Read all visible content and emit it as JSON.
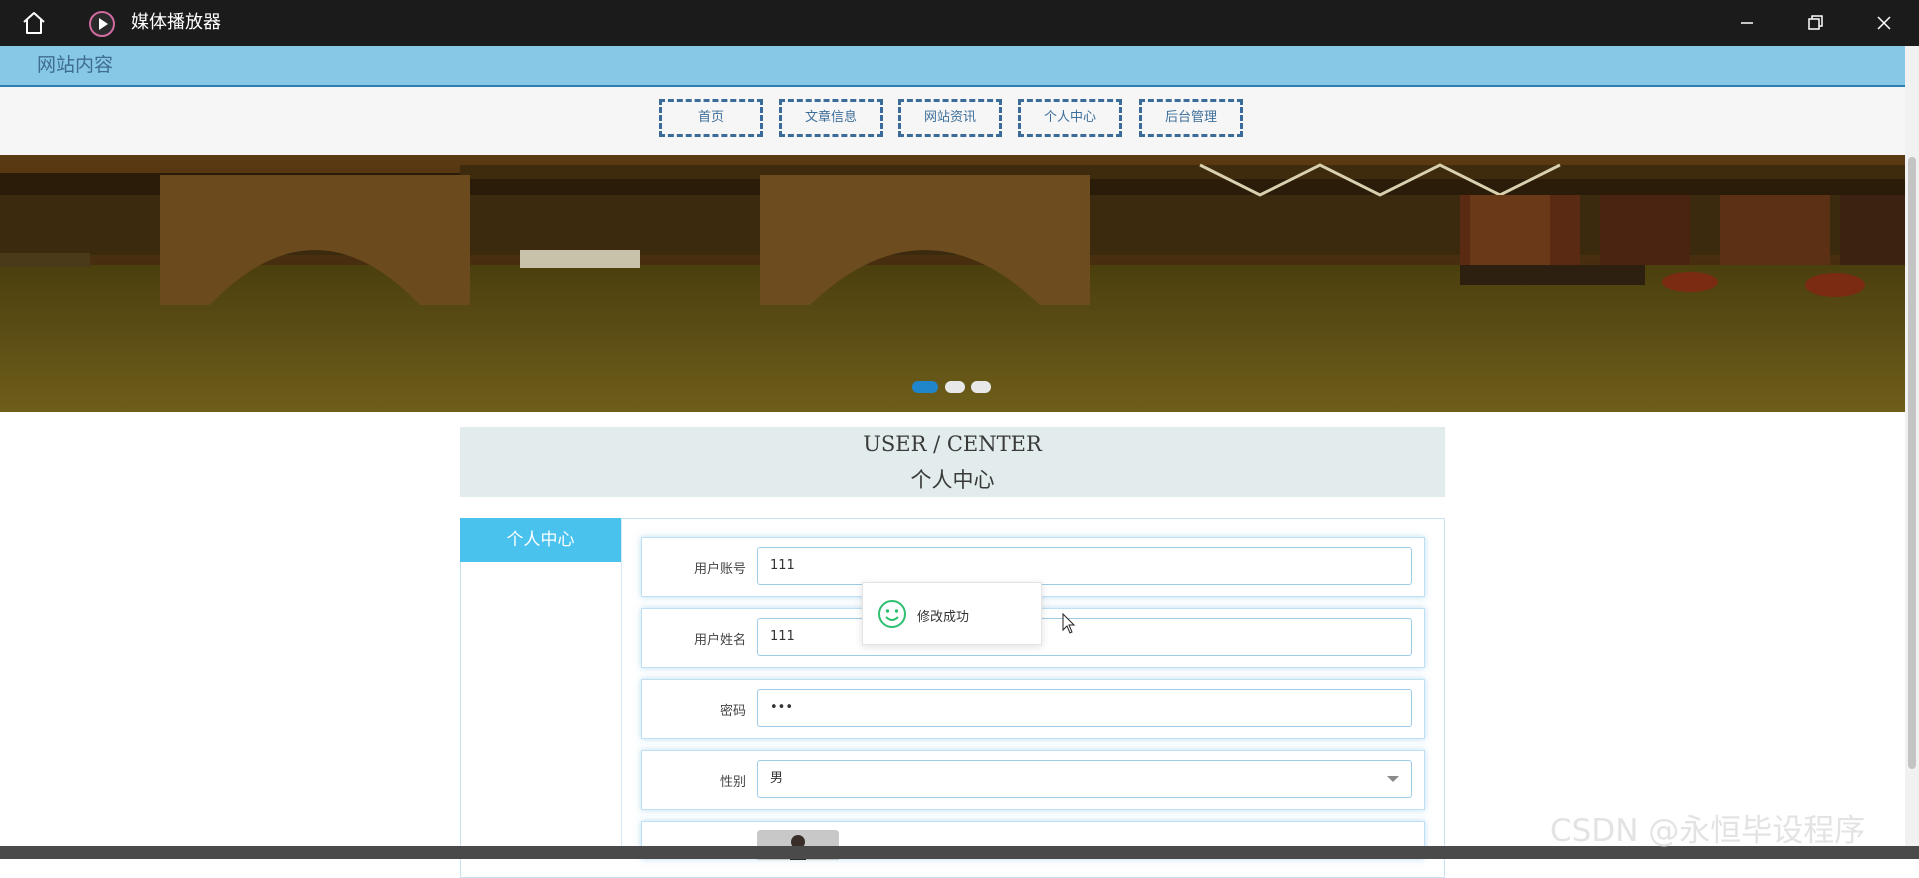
{
  "window": {
    "title": "媒体播放器",
    "icons": {
      "home": "home-icon",
      "app": "play-circle-icon",
      "minimize": "minimize-icon",
      "maximize": "restore-icon",
      "close": "close-icon"
    }
  },
  "site": {
    "header_title": "网站内容"
  },
  "nav": {
    "items": [
      {
        "label": "首页"
      },
      {
        "label": "文章信息"
      },
      {
        "label": "网站资讯"
      },
      {
        "label": "个人中心"
      },
      {
        "label": "后台管理"
      }
    ]
  },
  "carousel": {
    "slides": 3,
    "active_index": 0
  },
  "user_center": {
    "title_en": "USER / CENTER",
    "title_cn": "个人中心",
    "sidebar_title": "个人中心"
  },
  "form": {
    "fields": [
      {
        "label": "用户账号",
        "value": "111"
      },
      {
        "label": "用户姓名",
        "value": "111"
      },
      {
        "label": "密码",
        "value": "•••"
      },
      {
        "label": "性别",
        "value": "男"
      }
    ]
  },
  "toast": {
    "message": "修改成功",
    "icon": "smile-icon"
  },
  "watermark": "CSDN @永恒毕设程序",
  "colors": {
    "header_bg": "#87c8e6",
    "nav_border": "#3b6b98",
    "sidebar_accent": "#49c2ee",
    "success": "#2fbf71"
  }
}
